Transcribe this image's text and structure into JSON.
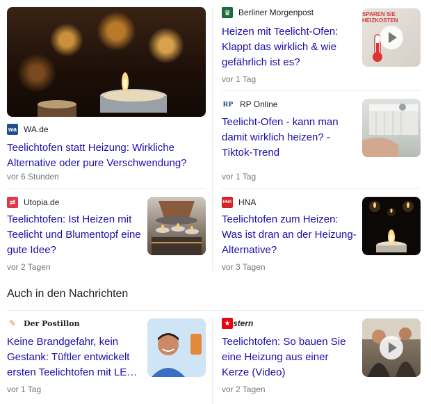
{
  "stories": [
    {
      "source": "WA.de",
      "logo_text": "wa",
      "headline": "Teelichtofen statt Heizung: Wirkliche Alternative oder pure Verschwendung?",
      "time": "vor 6 Stunden"
    },
    {
      "source": "Berliner Morgenpost",
      "logo_text": "♛",
      "headline": "Heizen mit Teelicht-Ofen: Klappt das wirklich & wie gefährlich ist es?",
      "time": "vor 1 Tag",
      "thumb_text": "SPAREN SIE HEIZKOSTEN"
    },
    {
      "source": "RP Online",
      "logo_text": "RP",
      "headline": "Teelicht-Ofen - kann man damit wirklich heizen? - Tiktok-Trend",
      "time": "vor 1 Tag"
    },
    {
      "source": "Utopia.de",
      "logo_text": "⇄",
      "headline": "Teelichtofen: Ist Heizen mit Teelicht und Blumentopf eine gute Idee?",
      "time": "vor 2 Tagen"
    },
    {
      "source": "HNA",
      "logo_text": "HNA",
      "headline": "Teelichtofen zum Heizen: Was ist dran an der Heizung-Alternative?",
      "time": "vor 3 Tagen"
    }
  ],
  "section_title": "Auch in den Nachrichten",
  "also": [
    {
      "source": "Der Postillon",
      "headline": "Keine Brandgefahr, kein Gestank: Tüftler entwickelt ersten Teelichtofen mit LE…",
      "time": "vor 1 Tag"
    },
    {
      "source": "stern",
      "headline": "Teelichtofen: So bauen Sie eine Heizung aus einer Kerze (Video)",
      "time": "vor 2 Tagen"
    }
  ],
  "colors": {
    "link": "#1a0dab",
    "meta": "#70757a",
    "divider": "#ebebeb"
  }
}
